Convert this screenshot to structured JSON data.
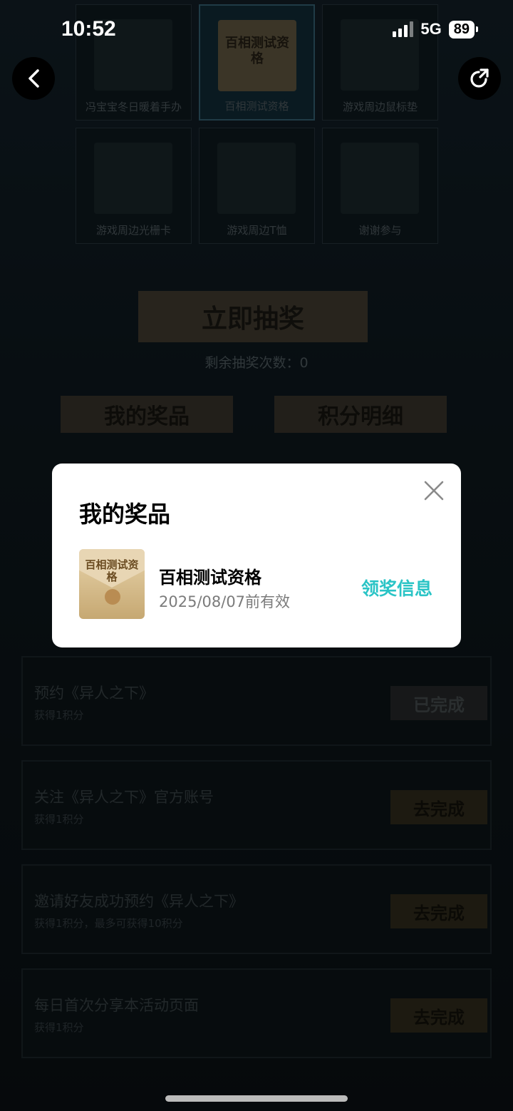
{
  "status_bar": {
    "time": "10:52",
    "network": "5G",
    "battery": "89"
  },
  "prize_grid": [
    {
      "label": "冯宝宝冬日暖着手办"
    },
    {
      "label": "百相测试资格",
      "art_text": "百相测试资格",
      "selected": true
    },
    {
      "label": "游戏周边鼠标垫"
    },
    {
      "label": "游戏周边光栅卡"
    },
    {
      "label": "游戏周边T恤"
    },
    {
      "label": "谢谢参与"
    }
  ],
  "draw": {
    "button_label": "立即抽奖",
    "remaining_label": "剩余抽奖次数：0"
  },
  "tabs": {
    "my_prizes": "我的奖品",
    "points_detail": "积分明细"
  },
  "tasks": [
    {
      "title": "预约《异人之下》",
      "subtitle": "获得1积分",
      "button": "已完成",
      "done": true
    },
    {
      "title": "关注《异人之下》官方账号",
      "subtitle": "获得1积分",
      "button": "去完成",
      "done": false
    },
    {
      "title": "邀请好友成功预约《异人之下》",
      "subtitle": "获得1积分，最多可获得10积分",
      "button": "去完成",
      "done": false
    },
    {
      "title": "每日首次分享本活动页面",
      "subtitle": "获得1积分",
      "button": "去完成",
      "done": false
    }
  ],
  "modal": {
    "title": "我的奖品",
    "prize": {
      "name": "百相测试资格",
      "validity": "2025/08/07前有效",
      "image_text": "百相测试资格",
      "action": "领奖信息"
    },
    "accent_color": "#2ac4c6"
  }
}
